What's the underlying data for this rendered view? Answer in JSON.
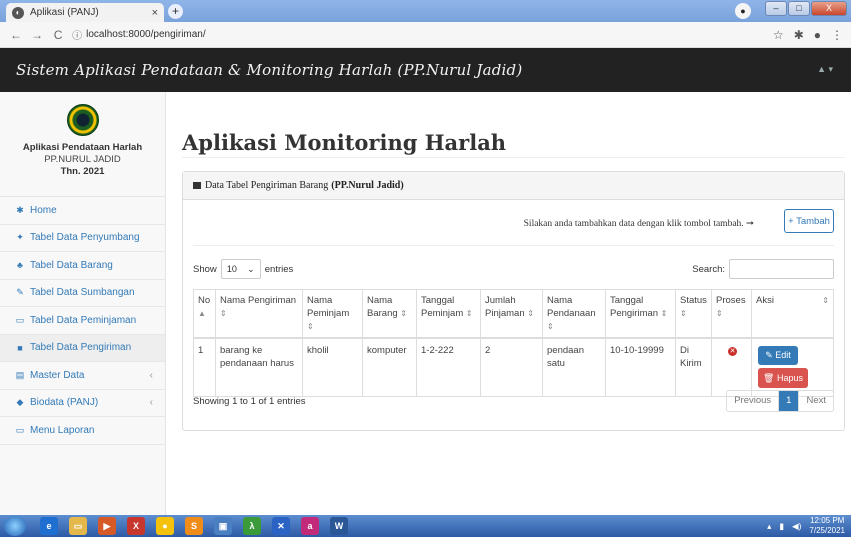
{
  "browser": {
    "tab_title": "Aplikasi (PANJ)",
    "tab_close": "×",
    "new_tab": "+",
    "url": "localhost:8000/pengiriman/",
    "win_buttons": [
      "–",
      "□",
      "X"
    ]
  },
  "navbar": {
    "brand": "Sistem Aplikasi Pendataan & Monitoring Harlah (PP.Nurul Jadid)",
    "user_icon": "▲ ▾"
  },
  "sidebar": {
    "app_name": "Aplikasi Pendataan Harlah",
    "org": "PP.NURUL JADID",
    "year": "Thn. 2021",
    "items": [
      {
        "label": "Home",
        "icon": "✱"
      },
      {
        "label": "Tabel Data Penyumbang",
        "icon": "✦"
      },
      {
        "label": "Tabel Data Barang",
        "icon": "♣"
      },
      {
        "label": "Tabel Data Sumbangan",
        "icon": "✎"
      },
      {
        "label": "Tabel Data Peminjaman",
        "icon": "▭"
      },
      {
        "label": "Tabel Data Pengiriman",
        "icon": "■"
      },
      {
        "label": "Master Data",
        "icon": "▤",
        "caret": "‹"
      },
      {
        "label": "Biodata (PANJ)",
        "icon": "◆",
        "caret": "‹"
      },
      {
        "label": "Menu Laporan",
        "icon": "▭"
      }
    ]
  },
  "main": {
    "page_title": "Aplikasi Monitoring Harlah",
    "panel_title": "Data Tabel Pengiriman Barang ",
    "panel_title_bold": "(PP.Nurul Jadid)",
    "tip": "Silakan anda tambahkan data dengan klik tombol tambah. ➞",
    "add_button": "+ Tambah",
    "show_label": "Show",
    "entries_value": "10",
    "entries_label": "entries",
    "search_label": "Search:",
    "columns": [
      "No",
      "Nama Pengiriman",
      "Nama Peminjam",
      "Nama Barang",
      "Tanggal Peminjam",
      "Jumlah Pinjaman",
      "Nama Pendanaan",
      "Tanggal Pengiriman",
      "Status",
      "Proses",
      "Aksi"
    ],
    "rows": [
      {
        "no": "1",
        "nama_pengiriman": "barang ke pendanaan harus",
        "nama_peminjam": "kholil",
        "nama_barang": "komputer",
        "tanggal_peminjam": "1-2-222",
        "jumlah_pinjaman": "2",
        "nama_pendanaan": "pendaan satu",
        "tanggal_pengiriman": "10-10-19999",
        "status": "Di Kirim",
        "edit": "✎ Edit",
        "hapus": "🗑 Hapus"
      }
    ],
    "info": "Showing 1 to 1 of 1 entries",
    "pager": {
      "prev": "Previous",
      "current": "1",
      "next": "Next"
    }
  },
  "taskbar": {
    "time": "12:05 PM",
    "date": "7/25/2021"
  }
}
